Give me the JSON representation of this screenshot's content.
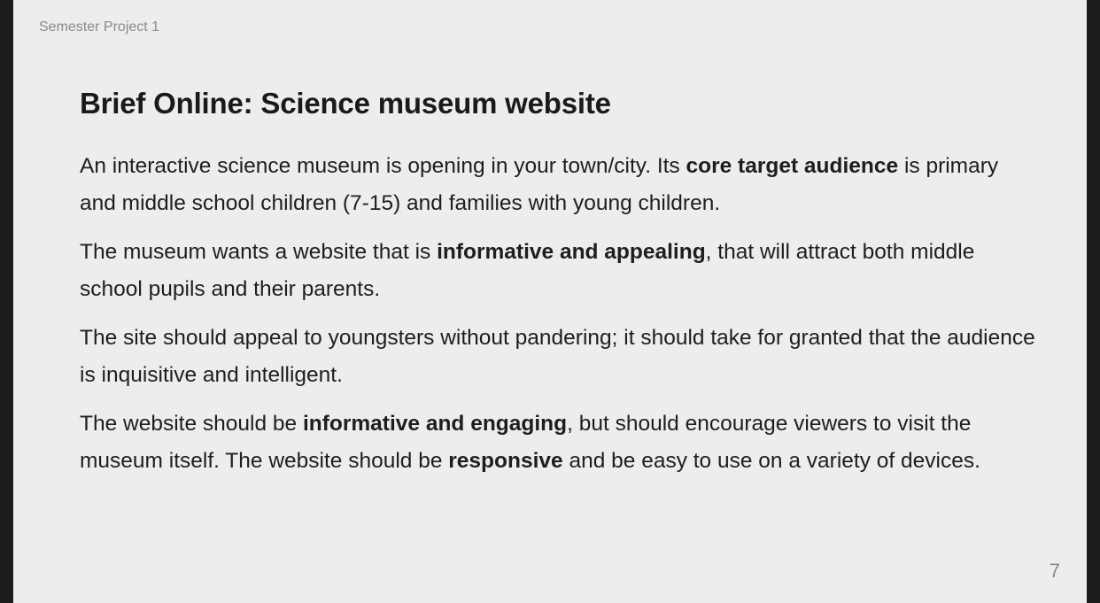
{
  "header": {
    "label": "Semester Project 1"
  },
  "title": "Brief Online: Science museum website",
  "paragraphs": [
    {
      "segments": [
        {
          "text": "An interactive science museum is opening in your town/city. Its ",
          "bold": false
        },
        {
          "text": "core target audience",
          "bold": true
        },
        {
          "text": " is primary and middle school children (7-15) and families with young children.",
          "bold": false
        }
      ]
    },
    {
      "segments": [
        {
          "text": "The museum wants a website that is ",
          "bold": false
        },
        {
          "text": "informative and appealing",
          "bold": true
        },
        {
          "text": ", that will attract both middle school pupils and their parents.",
          "bold": false
        }
      ]
    },
    {
      "segments": [
        {
          "text": "The site should appeal to youngsters without pandering; it should take for granted that the audience is inquisitive and intelligent.",
          "bold": false
        }
      ]
    },
    {
      "segments": [
        {
          "text": "The website should be ",
          "bold": false
        },
        {
          "text": "informative and engaging",
          "bold": true
        },
        {
          "text": ", but should encourage viewers to visit the museum itself. The website should be ",
          "bold": false
        },
        {
          "text": "responsive",
          "bold": true
        },
        {
          "text": " and be easy to use on a variety of devices.",
          "bold": false
        }
      ]
    }
  ],
  "page_number": "7"
}
